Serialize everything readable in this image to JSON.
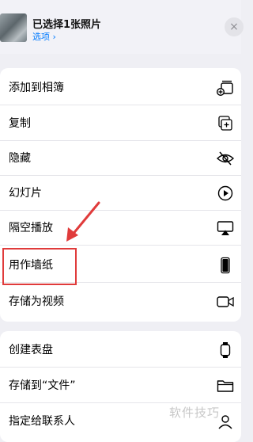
{
  "header": {
    "title": "已选择1张照片",
    "options_label": "选项 ›",
    "close_glyph": "×"
  },
  "group1": {
    "items": [
      {
        "label": "添加到相簿",
        "icon": "add-to-album-icon"
      },
      {
        "label": "复制",
        "icon": "copy-icon"
      },
      {
        "label": "隐藏",
        "icon": "hide-eye-icon"
      },
      {
        "label": "幻灯片",
        "icon": "play-circle-icon"
      },
      {
        "label": "隔空播放",
        "icon": "airplay-icon"
      },
      {
        "label": "用作墙纸",
        "icon": "iphone-icon"
      },
      {
        "label": "存储为视频",
        "icon": "video-camera-icon"
      }
    ]
  },
  "group2": {
    "items": [
      {
        "label": "创建表盘",
        "icon": "watch-icon"
      },
      {
        "label": "存储到“文件”",
        "icon": "folder-icon"
      },
      {
        "label": "指定给联系人",
        "icon": "contact-icon"
      }
    ]
  },
  "watermark": "软件技巧",
  "colors": {
    "accent": "#007aff",
    "highlight": "#e03b3b",
    "background": "#efeff4"
  }
}
